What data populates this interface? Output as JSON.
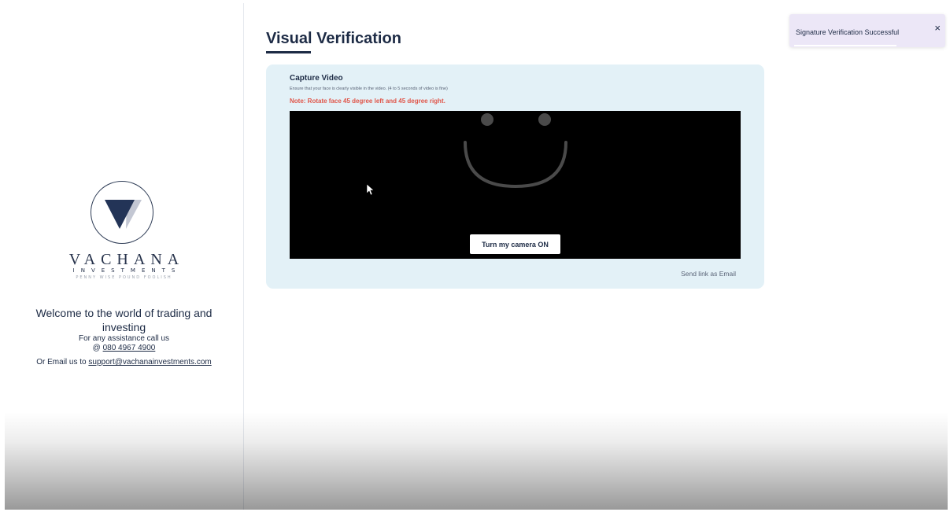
{
  "sidebar": {
    "brand_name": "VACHANA",
    "brand_sub": "INVESTMENTS",
    "brand_tagline": "PENNY WISE POUND FOOLISH",
    "welcome": "Welcome to the world of trading and investing",
    "assist_prefix": "For any assistance call us",
    "phone_prefix": "@ ",
    "phone": "080 4967 4900",
    "email_prefix": "Or Email us to ",
    "email": "support@vachanainvestments.com"
  },
  "main": {
    "title": "Visual Verification",
    "card": {
      "title": "Capture Video",
      "description": "Ensure that your face is clearly visible in the video. (4 to 5 seconds of video is fine)",
      "note": "Note: Rotate face 45 degree left and 45 degree right.",
      "camera_button": "Turn my camera ON",
      "send_link": "Send link as Email"
    }
  },
  "toast": {
    "message": "Signature Verification Successful",
    "close_symbol": "×"
  },
  "colors": {
    "navy": "#1d2b45",
    "card_bg": "#e3f1f7",
    "note_red": "#e0564a",
    "toast_bg": "#ece7f7"
  },
  "icons": {
    "logo": "vachana-triangle-logo",
    "video_placeholder": "smiley-face-icon",
    "cursor": "mouse-pointer-icon"
  }
}
